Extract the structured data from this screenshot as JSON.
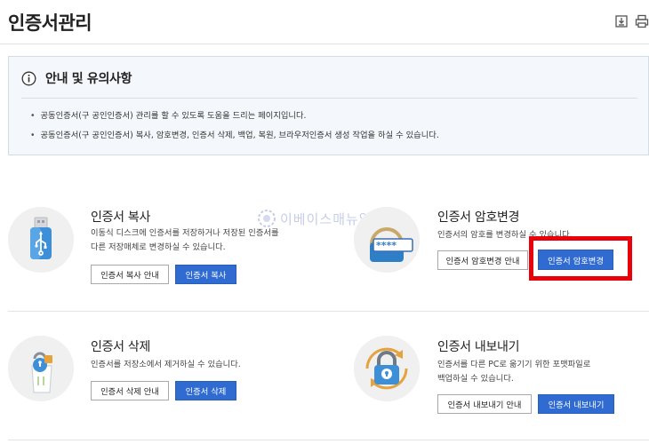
{
  "header": {
    "title": "인증서관리",
    "icons": [
      "download-icon",
      "print-icon"
    ]
  },
  "notice": {
    "title": "안내 및 유의사항",
    "items": [
      "공동인증서(구 공인인증서) 관리를 할 수 있도록 도움을 드리는 페이지입니다.",
      "공동인증서(구 공인인증서) 복사, 암호변경, 인증서 삭제, 백업, 복원, 브라우저인증서 생성 작업을 하실 수 있습니다."
    ]
  },
  "cards": {
    "copy": {
      "title": "인증서 복사",
      "desc": [
        "이동식 디스크에 인증서를 저장하거나 저장된 인증서를",
        "다른 저장매체로 변경하실 수 있습니다."
      ],
      "guide_label": "인증서 복사 안내",
      "action_label": "인증서 복사",
      "icon": "usb-drive-icon"
    },
    "password": {
      "title": "인증서 암호변경",
      "desc": [
        "인증서의 암호를 변경하실 수 있습니다."
      ],
      "guide_label": "인증서 암호변경 안내",
      "action_label": "인증서 암호변경",
      "icon": "password-lock-icon",
      "password_mask": "****"
    },
    "delete": {
      "title": "인증서 삭제",
      "desc": [
        "인증서를 저장소에서 제거하실 수 있습니다."
      ],
      "guide_label": "인증서 삭제 안내",
      "action_label": "인증서 삭제",
      "icon": "trash-lock-icon"
    },
    "export": {
      "title": "인증서 내보내기",
      "desc": [
        "인증서를 다른 PC로 옮기기 위한 포맷파일로",
        "백업하실 수 있습니다."
      ],
      "guide_label": "인증서 내보내기 안내",
      "action_label": "인증서 내보내기",
      "icon": "lock-sync-icon"
    }
  },
  "watermark": {
    "text": "이베이스매뉴얼"
  },
  "colors": {
    "primary_button": "#2f6bd1",
    "highlight": "#e8000b",
    "notice_bg": "#f4f7fb",
    "icon_bg": "#f0f0f0"
  }
}
